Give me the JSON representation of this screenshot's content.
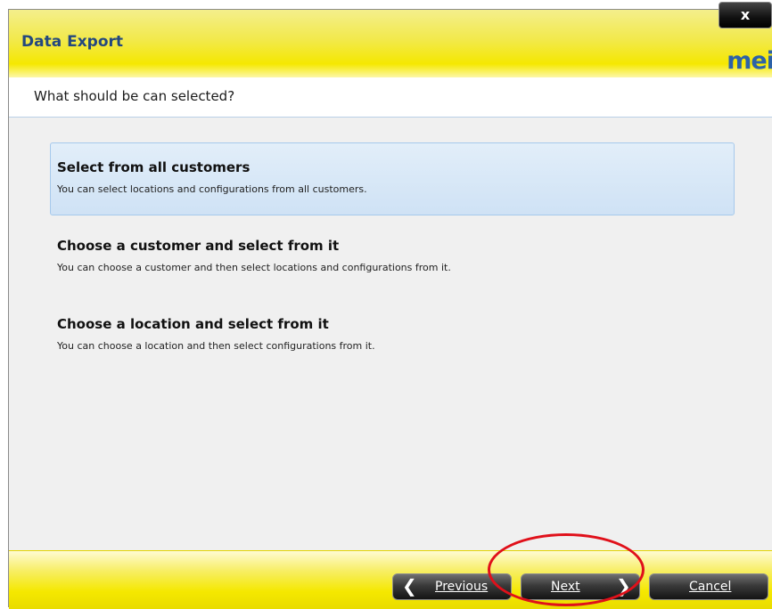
{
  "window": {
    "title": "Data Export",
    "logo_text": "mei",
    "close_label": "x",
    "brand_colors": {
      "header_yellow": "#f5e800",
      "title_blue": "#24487e",
      "selection_blue": "#cfe2f5"
    }
  },
  "subheader": {
    "text": "What should be can selected?"
  },
  "options": [
    {
      "title": "Select from all customers",
      "description": "You can select locations and configurations from all customers.",
      "selected": true
    },
    {
      "title": "Choose a customer and select from it",
      "description": "You can choose a customer and then select locations and configurations from it.",
      "selected": false
    },
    {
      "title": "Choose a location and select from it",
      "description": "You can choose a location and then select configurations from it.",
      "selected": false
    }
  ],
  "footer": {
    "previous_label": "Previous",
    "previous_icon": "chevron-left-icon",
    "next_label": "Next",
    "next_icon": "chevron-right-icon",
    "cancel_label": "Cancel"
  },
  "annotation": {
    "highlight_color": "#e0101a",
    "target": "next-button"
  }
}
